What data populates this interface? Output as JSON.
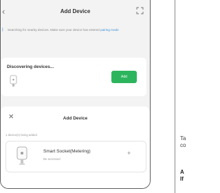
{
  "header": {
    "title": "Add Device",
    "back_icon": "chevron-left-icon",
    "scan_icon": "scan-icon"
  },
  "notice": {
    "text": "Searching for nearby devices. Make sure your device has entered",
    "link": "pairing mode",
    "icon": "bluetooth-icon",
    "link_color": "#3b8fd9"
  },
  "discovering": {
    "title": "Discovering devices...",
    "add_label": "Add",
    "add_color": "#2db55d"
  },
  "sheet": {
    "title": "Add Device",
    "found_label": "1 device(s) being added",
    "device": {
      "name": "Smart Socket(Metering)",
      "status": "Be accessed"
    }
  },
  "right_panel": {
    "line1": "Ta",
    "line2": "co",
    "line3": "A",
    "line4": "If"
  }
}
